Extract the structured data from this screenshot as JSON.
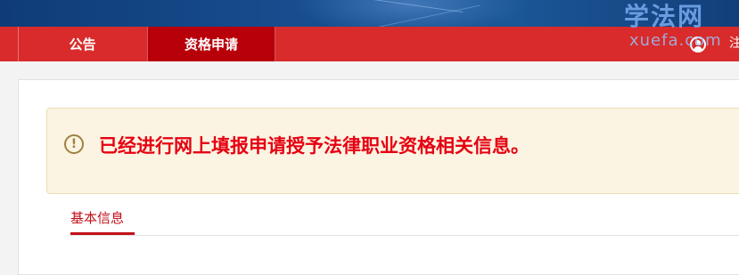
{
  "nav": {
    "items": [
      {
        "label": "公告",
        "active": false
      },
      {
        "label": "资格申请",
        "active": true
      }
    ],
    "partial_text": "注"
  },
  "watermark": {
    "cn": "学法网",
    "en": "xuefa.com"
  },
  "notice": {
    "icon": "exclamation-circle-icon",
    "text": "已经进行网上填报申请授予法律职业资格相关信息。"
  },
  "tabs": [
    {
      "label": "基本信息",
      "active": true
    }
  ],
  "colors": {
    "header_blue": "#174d8e",
    "nav_red": "#d92b2b",
    "nav_active": "#b8000b",
    "notice_bg": "#fbf4e2",
    "notice_text": "#e60012",
    "tab_active": "#c2111a"
  }
}
